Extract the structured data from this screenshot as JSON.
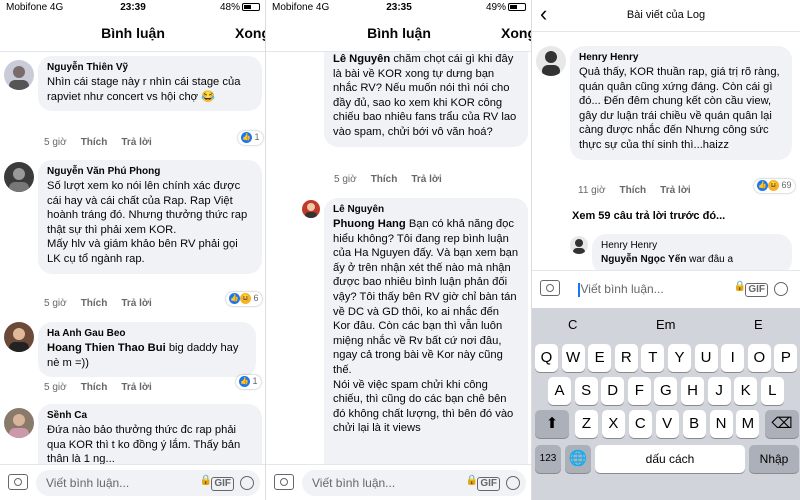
{
  "panel1": {
    "status": {
      "carrier": "Mobifone  4G",
      "time": "23:39",
      "battery": "48%"
    },
    "nav": {
      "title": "Bình luận",
      "done": "Xong"
    },
    "comments": [
      {
        "author": "Nguyễn Thiên Vỹ",
        "text": "Nhìn cái stage này r nhìn cái stage của rapviet như concert vs hội chợ 😂",
        "time": "5 giờ",
        "like": "Thích",
        "reply": "Trả lời",
        "reactions": "1"
      },
      {
        "author": "Nguyễn Văn Phú Phong",
        "text": "Số lượt xem ko nói lên chính xác được cái hay và cái chất của Rap. Rap Việt hoành tráng đó. Nhưng thưởng thức rap thật sự thì phải xem KOR.\nMấy hlv và giám khảo bên RV phải gọi LK cụ tổ ngành rap.",
        "time": "5 giờ",
        "like": "Thích",
        "reply": "Trả lời",
        "reactions": "6"
      },
      {
        "author": "Ha Anh Gau Beo",
        "mention": "Hoang Thien Thao Bui",
        "text": " big daddy hay nè m =))",
        "time": "5 giờ",
        "like": "Thích",
        "reply": "Trả lời",
        "reactions": "1"
      },
      {
        "author": "Sềnh Ca",
        "text": "Đứa nào bảo thưởng thức đc rap phải qua KOR thì t ko đồng ý lắm. Thấy bản thân là 1 ng..."
      }
    ],
    "input_placeholder": "Viết bình luận..."
  },
  "panel2": {
    "status": {
      "carrier": "Mobifone  4G",
      "time": "23:35",
      "battery": "49%"
    },
    "nav": {
      "title": "Bình luận",
      "done": "Xong"
    },
    "comments": [
      {
        "author": "Lê Nguyên",
        "text": "chăm chọt cái gì khi đây là bài về KOR xong tự dưng bạn nhắc RV? Nếu muốn nói thì nói cho đầy đủ, sao ko xem khi KOR công chiếu bao nhiêu fans trẩu của RV lao vào spam, chửi bới vô văn hoá?",
        "time": "5 giờ",
        "like": "Thích",
        "reply": "Trả lời"
      },
      {
        "author": "Lê Nguyên",
        "mention": "Phuong Hang",
        "text": " Bạn có khả năng đọc hiểu không? Tôi đang rep bình luận của Ha Nguyen đấy. Và bạn xem bạn ấy ở trên nhận xét thế nào mà nhận được bao nhiêu bình luận phản đối vậy? Tôi thấy bên RV giờ chỉ bàn tán về DC và GD thôi, ko ai nhắc đến Kor đâu. Còn các bạn thì vẫn luôn miệng nhắc về Rv bất cứ nơi đâu, ngay cả trong bài về Kor này cũng thế.\nNói về việc spam chửi khi công chiếu, thì cũng do các bạn chê bên đó không chất lượng, thì bên đó vào chửi lại là it views"
      }
    ],
    "input_placeholder": "Viết bình luận..."
  },
  "panel3": {
    "nav": {
      "back": "‹",
      "title": "Bài viết của Log"
    },
    "comments": [
      {
        "author": "Henry Henry",
        "text": "Quả thấy, KOR thuần rap, giá trị rõ ràng, quán quân cũng xứng đáng. Còn cái gì đó... Đến đêm chung kết còn cầu view, gây dư luận trái chiều về quán quân lại càng được nhắc đến Nhưng công sức thực sự của thí sinh thì...haizz",
        "time": "11 giờ",
        "like": "Thích",
        "reply": "Trả lời",
        "reactions": "69"
      },
      {
        "author": "Henry Henry",
        "mention": "Nguyễn Ngọc Yến",
        "text": " war đâu a"
      }
    ],
    "more_replies": "Xem 59 câu trả lời trước đó...",
    "input_placeholder": "Viết bình luận...",
    "keyboard": {
      "suggestions": [
        "C",
        "Em",
        "E"
      ],
      "row1": [
        "Q",
        "W",
        "E",
        "R",
        "T",
        "Y",
        "U",
        "I",
        "O",
        "P"
      ],
      "row2": [
        "A",
        "S",
        "D",
        "F",
        "G",
        "H",
        "J",
        "K",
        "L"
      ],
      "row3": [
        "Z",
        "X",
        "C",
        "V",
        "B",
        "N",
        "M"
      ],
      "numbers": "123",
      "space": "dấu cách",
      "return": "Nhập"
    }
  },
  "colors": {
    "bubble": "#f0f2f5",
    "like": "#1877f2",
    "haha": "#f7b125",
    "secondary_text": "#65676b",
    "keyboard_bg": "#d1d4db"
  }
}
